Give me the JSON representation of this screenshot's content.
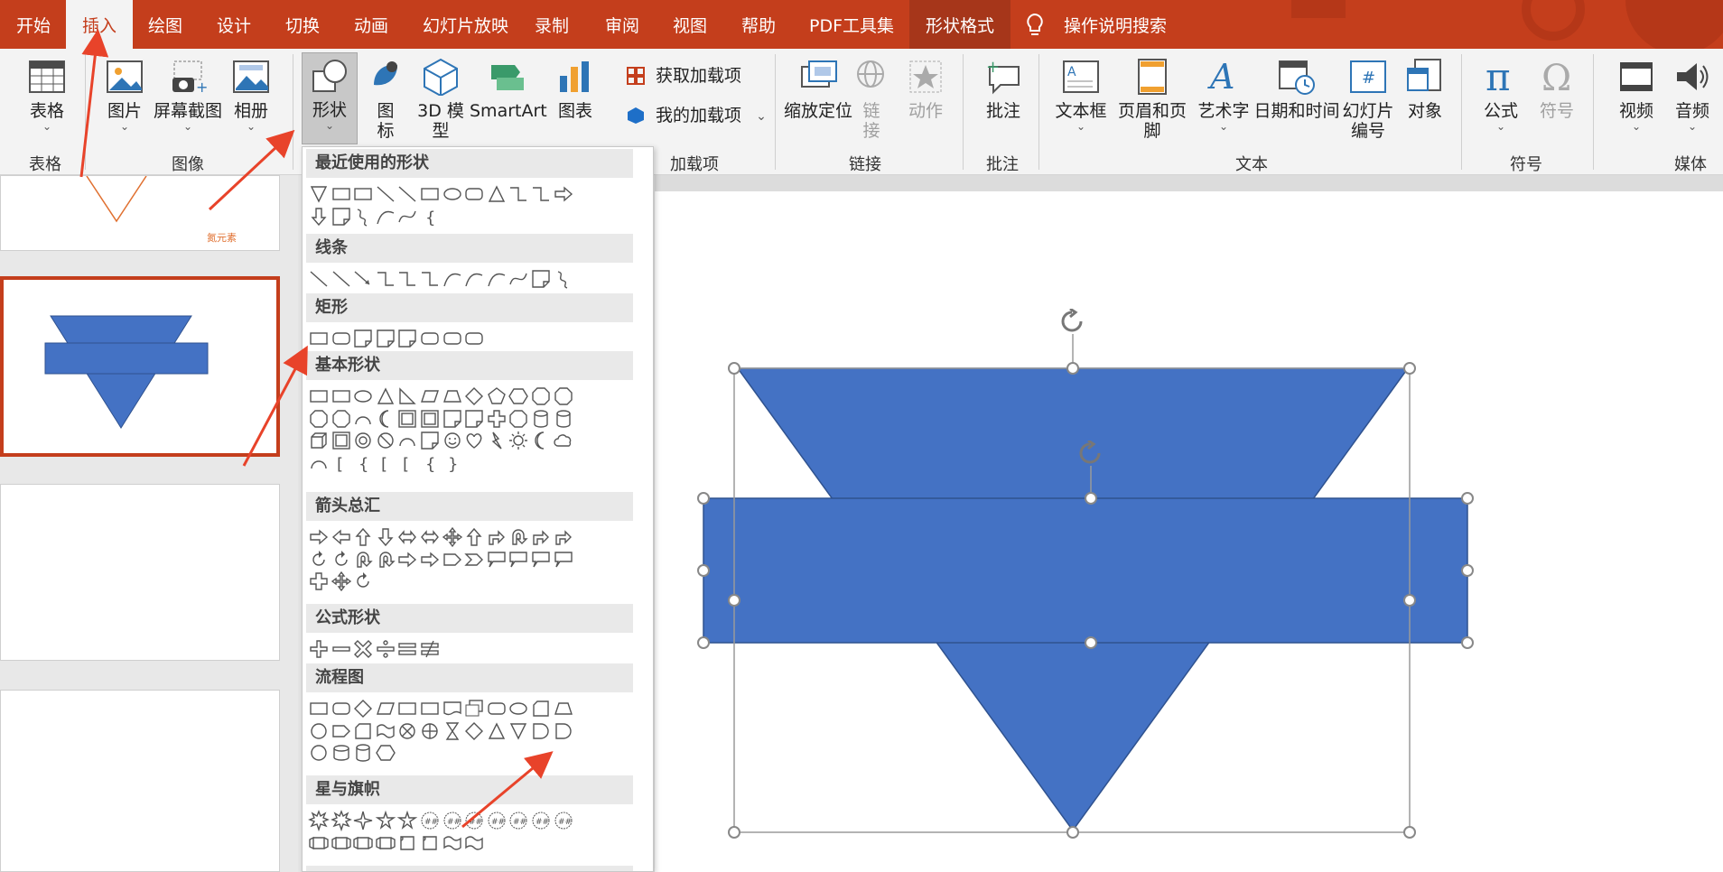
{
  "tabs": [
    "开始",
    "插入",
    "绘图",
    "设计",
    "切换",
    "动画",
    "幻灯片放映",
    "录制",
    "审阅",
    "视图",
    "帮助",
    "PDF工具集",
    "形状格式"
  ],
  "search_label": "操作说明搜索",
  "ribbon": {
    "table": "表格",
    "picture": "图片",
    "screenshot": "屏幕截图",
    "album": "相册",
    "shapes": "形状",
    "icons": "图标",
    "model3d": "3D 模型",
    "smartart": "SmartArt",
    "chart": "图表",
    "get_addins": "获取加载项",
    "my_addins": "我的加载项",
    "zoom": "缩放定位",
    "link": "链接",
    "action": "动作",
    "comment": "批注",
    "textbox": "文本框",
    "header_footer": "页眉和页脚",
    "wordart": "艺术字",
    "datetime": "日期和时间",
    "slide_number": "幻灯片编号",
    "object": "对象",
    "equation": "公式",
    "symbol": "符号",
    "video": "视频",
    "audio": "音频"
  },
  "groups": {
    "tables": "表格",
    "images": "图像",
    "addins": "加载项",
    "links": "链接",
    "comments": "批注",
    "text": "文本",
    "symbols": "符号",
    "media": "媒体"
  },
  "thumb_text": "氮元素",
  "gallery_sections": [
    "最近使用的形状",
    "线条",
    "矩形",
    "基本形状",
    "箭头总汇",
    "公式形状",
    "流程图",
    "星与旗帜"
  ],
  "colors": {
    "accent": "#c43e1c",
    "shape_fill": "#4472c4",
    "arrow": "#e8432a"
  }
}
